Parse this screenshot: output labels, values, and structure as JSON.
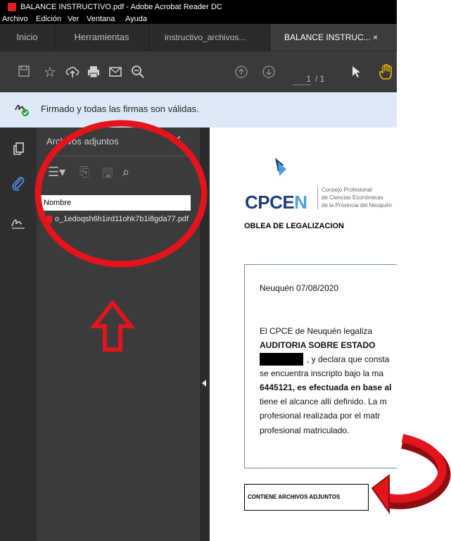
{
  "window": {
    "title": "BALANCE INSTRUCTIVO.pdf - Adobe Acrobat Reader DC"
  },
  "menu": [
    "Archivo",
    "Edición",
    "Ver",
    "Ventana",
    "Ayuda"
  ],
  "tabs": [
    {
      "label": "Inicio",
      "active": false
    },
    {
      "label": "Herramientas",
      "active": false
    },
    {
      "label": "instructivo_archivos...",
      "active": false
    },
    {
      "label": "BALANCE INSTRUC... ×",
      "active": true
    }
  ],
  "toolbar": {
    "icons": [
      "save-icon",
      "bookmark-star-icon",
      "cloud-upload-icon",
      "print-icon",
      "email-icon",
      "zoom-icon",
      "page-up-icon",
      "page-down-icon",
      "select-cursor-icon",
      "hand-icon"
    ],
    "page_current": "1",
    "page_total": "/ 1"
  },
  "signature_bar": {
    "text": "Firmado y todas las firmas son válidas."
  },
  "attachments_panel": {
    "title": "Archivos adjuntos",
    "column_header": "Nombre",
    "files": [
      {
        "name": "o_1edoqsh6h1ird11ohk7b1i8gda77.pdf"
      }
    ]
  },
  "document": {
    "logo_name": "CPCE",
    "logo_name_end": "N",
    "logo_sub": [
      "Consejo Profesional",
      "de Ciencias Económicas",
      "de la Provincia del Neuquén"
    ],
    "heading": "OBLEA DE LEGALIZACION",
    "date_line": "Neuquén 07/08/2020",
    "lines": [
      "El CPCE de Neuquén legaliza",
      "AUDITORIA SOBRE ESTADO",
      ", y declara que consta",
      "se encuentra inscripto bajo la ma",
      "6445121, es efectuada en base al",
      "tiene el alcance allí definido. La m",
      "profesional realizada por el matr",
      "profesional matriculado."
    ],
    "attachments_notice": "CONTIENE ARCHIVOS ADJUNTOS"
  },
  "colors": {
    "annotation_red": "#e3141b",
    "panel_bg": "#3b3b3b",
    "signature_bar_bg": "#dde9f6"
  }
}
